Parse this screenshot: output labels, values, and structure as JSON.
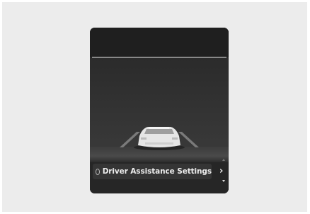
{
  "menu": {
    "label": "Driver Assistance Settings",
    "icon": "settings-circle-icon",
    "next_icon": "chevron-right-icon"
  },
  "scroll": {
    "up_icon": "scroll-up-icon",
    "down_icon": "scroll-down-icon"
  },
  "colors": {
    "screen_background": "#2a2a2a",
    "horizon_line": "#9a9a9a",
    "car_body": "#e6e6e6",
    "label_text": "#ededed"
  }
}
